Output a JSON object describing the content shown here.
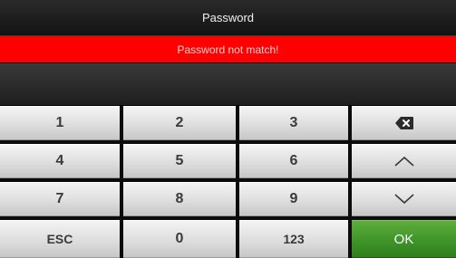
{
  "title": "Password",
  "error_message": "Password not match!",
  "keypad": {
    "keys": {
      "k1": "1",
      "k2": "2",
      "k3": "3",
      "k4": "4",
      "k5": "5",
      "k6": "6",
      "k7": "7",
      "k8": "8",
      "k9": "9",
      "esc": "ESC",
      "k0": "0",
      "mode": "123",
      "ok": "OK"
    },
    "icons": {
      "backspace": "backspace-icon",
      "up": "chevron-up-icon",
      "down": "chevron-down-icon"
    }
  },
  "colors": {
    "error_bg": "#ff0000",
    "ok_bg": "#3f9428",
    "key_bg": "#dedede"
  }
}
